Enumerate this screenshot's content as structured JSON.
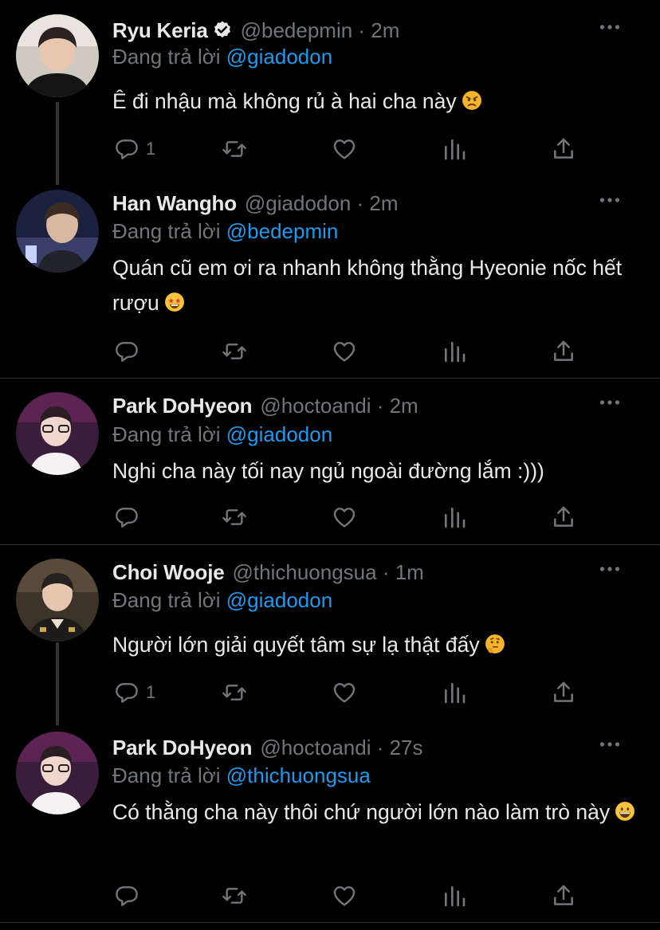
{
  "colors": {
    "background": "#000000",
    "text": "#e7e9ea",
    "muted": "#71767b",
    "link": "#1d9bf0",
    "divider": "#2f3336"
  },
  "icons": [
    "reply-icon",
    "retweet-icon",
    "like-icon",
    "analytics-icon",
    "share-icon",
    "more-icon",
    "verified-badge-icon"
  ],
  "tweets": [
    {
      "name": "Ryu Keria",
      "verified": true,
      "handle": "@bedepmin · 2m",
      "replying_prefix": "Đang trả lời ",
      "replying_to": "@giadodon",
      "text": "Ê đi nhậu mà không rủ à hai cha này",
      "emoji": "angry-face",
      "reply_count": "1"
    },
    {
      "name": "Han Wangho",
      "verified": false,
      "handle": "@giadodon · 2m",
      "replying_prefix": "Đang trả lời ",
      "replying_to": "@bedepmin",
      "text": "Quán cũ em ơi ra nhanh không thằng Hyeonie nốc hết rượu",
      "emoji": "star-struck",
      "reply_count": ""
    },
    {
      "name": "Park DoHyeon",
      "verified": false,
      "handle": "@hoctoandi · 2m",
      "replying_prefix": "Đang trả lời ",
      "replying_to": "@giadodon",
      "text": "Nghi cha này tối nay ngủ ngoài đường lắm :)))",
      "emoji": "",
      "reply_count": ""
    },
    {
      "name": "Choi Wooje",
      "verified": false,
      "handle": "@thichuongsua · 1m",
      "replying_prefix": "Đang trả lời ",
      "replying_to": "@giadodon",
      "text": "Người lớn giải quyết tâm sự lạ thật đấy",
      "emoji": "thinking-face",
      "reply_count": "1"
    },
    {
      "name": "Park DoHyeon",
      "verified": false,
      "handle": "@hoctoandi · 27s",
      "replying_prefix": "Đang trả lời ",
      "replying_to": "@thichuongsua",
      "text": "Có thằng cha này thôi chứ người lớn nào làm trò này",
      "emoji": "grinning-face",
      "reply_count": ""
    }
  ]
}
